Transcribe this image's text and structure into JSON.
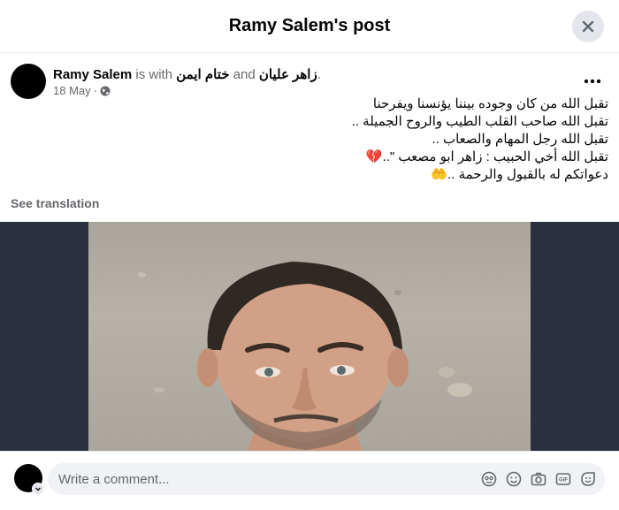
{
  "header": {
    "title": "Ramy Salem's post"
  },
  "post": {
    "author": "Ramy Salem",
    "with_text": "is with",
    "tagged_1": "ختام ايمن",
    "and_text": "and",
    "tagged_2": "زاهر عليان",
    "end_punct": ".",
    "date": "18 May",
    "date_sep": "·",
    "privacy_icon": "globe-icon",
    "lines": [
      "تقبل الله من كان وجوده بيننا يؤنسنا ويفرحنا",
      "تقبل الله صاحب القلب الطيب والروح الجميلة ..",
      "تقبل الله رجل المهام والصعاب ..",
      "تقبل الله أخي الحبيب : زاهر ابو مصعب \"..",
      "دعواتكم له بالقبول والرحمة .."
    ],
    "emoji_broken_heart": "💔",
    "emoji_hands": "🤲",
    "see_translation": "See translation"
  },
  "comment": {
    "placeholder": "Write a comment..."
  },
  "colors": {
    "accent_bg": "#e4e6eb",
    "media_bg": "#2b3040",
    "secondary_text": "#65676b"
  }
}
